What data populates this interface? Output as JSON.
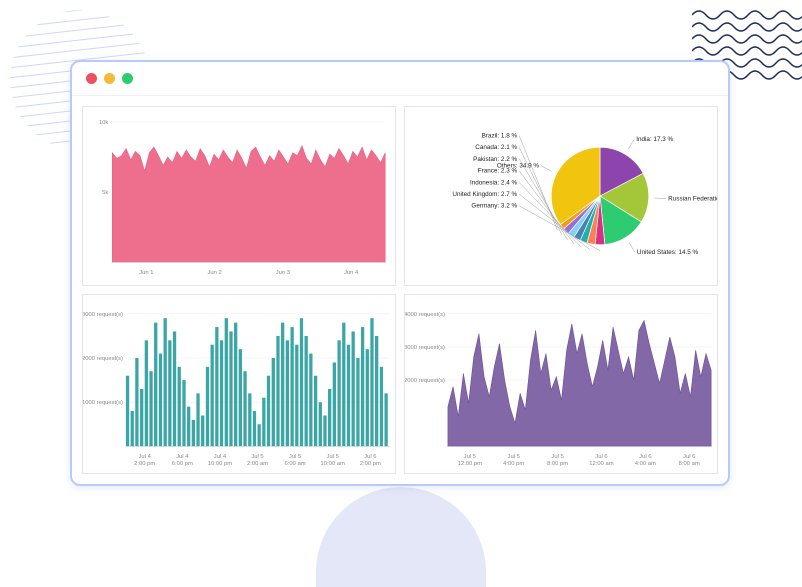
{
  "window": {
    "dots": [
      "red",
      "yellow",
      "green"
    ]
  },
  "chart_data": [
    {
      "id": "area_pink",
      "type": "area",
      "color": "#ec5e82",
      "y_ticks": [
        "10k",
        "5k"
      ],
      "x_ticks": [
        "Jun 1",
        "Jun 2",
        "Jun 3",
        "Jun 4"
      ],
      "values": [
        7.8,
        7.4,
        7.6,
        8.1,
        7.3,
        7.9,
        7.6,
        6.5,
        7.8,
        8.2,
        7.6,
        6.9,
        7.5,
        7.1,
        7.9,
        7.4,
        8.0,
        7.5,
        7.2,
        8.1,
        7.6,
        6.8,
        7.7,
        7.3,
        8.0,
        7.5,
        7.1,
        8.0,
        7.4,
        6.7,
        7.9,
        8.2,
        7.5,
        6.9,
        7.6,
        7.2,
        8.0,
        7.5,
        7.0,
        7.8,
        7.6,
        8.3,
        7.4,
        7.0,
        8.0,
        7.3,
        6.8,
        7.7,
        7.4,
        8.1,
        7.6,
        7.0,
        7.9,
        7.5,
        8.2,
        7.3,
        8.0,
        7.6,
        7.1,
        7.8
      ]
    },
    {
      "id": "pie_countries",
      "type": "pie",
      "slices": [
        {
          "label": "India",
          "value": 17.3,
          "color": "#8e44ad"
        },
        {
          "label": "Russian Federation",
          "value": 16.6,
          "color": "#a4c639"
        },
        {
          "label": "United States",
          "value": 14.5,
          "color": "#2ecc71"
        },
        {
          "label": "Germany",
          "value": 3.2,
          "color": "#d63384"
        },
        {
          "label": "United Kingdom",
          "value": 2.7,
          "color": "#ff7f50"
        },
        {
          "label": "Indonesia",
          "value": 2.4,
          "color": "#20b2aa"
        },
        {
          "label": "France",
          "value": 2.3,
          "color": "#4682b4"
        },
        {
          "label": "Pakistan",
          "value": 2.2,
          "color": "#87cefa"
        },
        {
          "label": "Canada",
          "value": 2.1,
          "color": "#9370db"
        },
        {
          "label": "Brazil",
          "value": 1.8,
          "color": "#f39c12"
        },
        {
          "label": "Others",
          "value": 34.9,
          "color": "#f1c40f"
        }
      ]
    },
    {
      "id": "bars_teal",
      "type": "bar",
      "color": "#3aa6a6",
      "y_ticks": [
        "3000 request(s)",
        "2000 request(s)",
        "1000 request(s)"
      ],
      "x_ticks": [
        "Jul 4\n2:00 pm",
        "Jul 4\n6:00 pm",
        "Jul 4\n10:00 pm",
        "Jul 5\n2:00 am",
        "Jul 5\n6:00 am",
        "Jul 5\n10:00 am",
        "Jul 6\n2:00 pm"
      ],
      "values": [
        1600,
        800,
        2000,
        1300,
        2400,
        1700,
        2800,
        2100,
        2900,
        2400,
        2600,
        1800,
        1500,
        900,
        600,
        1200,
        700,
        1800,
        2300,
        2700,
        2400,
        2900,
        2600,
        2800,
        2200,
        1700,
        1200,
        800,
        500,
        1100,
        1600,
        2000,
        2500,
        2800,
        2400,
        2700,
        2300,
        2900,
        2500,
        2100,
        1600,
        1000,
        700,
        1300,
        1900,
        2400,
        2800,
        2300,
        2600,
        2000,
        2700,
        2200,
        2900,
        2500,
        1800,
        1200
      ]
    },
    {
      "id": "area_purple",
      "type": "area",
      "color": "#6c4e97",
      "y_ticks": [
        "4000 request(s)",
        "3000 request(s)",
        "2000 request(s)"
      ],
      "x_ticks": [
        "Jul 5\n12:00 pm",
        "Jul 5\n4:00 pm",
        "Jul 5\n8:00 pm",
        "Jul 6\n12:00 am",
        "Jul 6\n4:00 am",
        "Jul 6\n8:00 am"
      ],
      "values": [
        1200,
        1800,
        900,
        2200,
        1300,
        2700,
        3400,
        2100,
        1500,
        2400,
        3100,
        2000,
        1200,
        700,
        1600,
        1100,
        2600,
        3500,
        2200,
        2800,
        1700,
        2100,
        1400,
        2900,
        3700,
        2800,
        3400,
        2500,
        1800,
        2400,
        3200,
        2300,
        3600,
        2900,
        2200,
        2700,
        2000,
        3500,
        3800,
        3100,
        2500,
        1900,
        2600,
        3300,
        2700,
        1600,
        2200,
        1500,
        2900,
        2100,
        2800,
        2300
      ]
    }
  ]
}
